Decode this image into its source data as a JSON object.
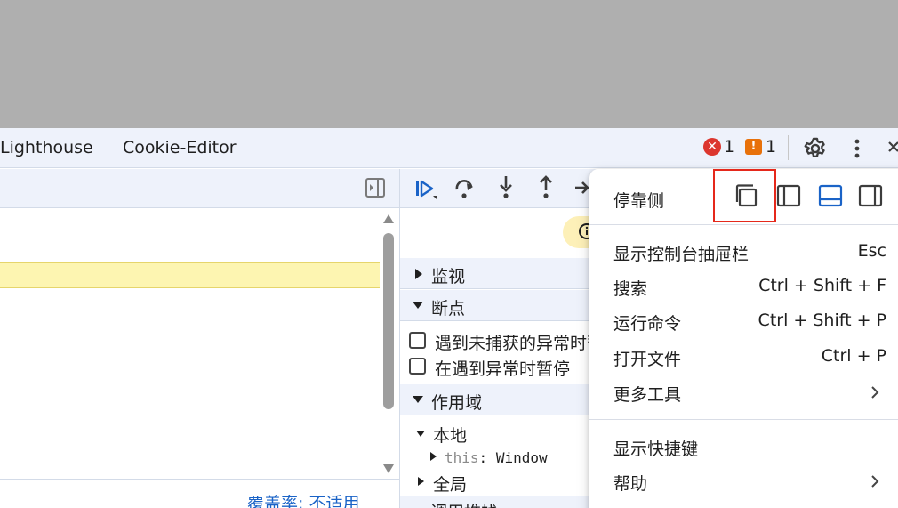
{
  "tabs": {
    "lighthouse": "Lighthouse",
    "cookie_editor": "Cookie-Editor"
  },
  "status": {
    "errors": "1",
    "warnings": "1",
    "error_icon_glyph": "✕",
    "warning_icon_glyph": "!"
  },
  "editor": {
    "coverage": "覆盖率: 不适用"
  },
  "debugger": {
    "sections": {
      "watch": "监视",
      "breakpoints": "断点",
      "scope": "作用域",
      "callstack": "调用堆栈"
    },
    "breakpoint_options": [
      "遇到未捕获的异常时暂停",
      "在遇到异常时暂停"
    ],
    "scope": {
      "local": "本地",
      "this_key": "this",
      "this_sep": ":",
      "this_value": "Window",
      "global": "全局"
    }
  },
  "menu": {
    "dock_label": "停靠侧",
    "dock_options": [
      "undock-into-separate-window-icon",
      "dock-to-left-icon",
      "dock-to-bottom-icon",
      "dock-to-right-icon"
    ],
    "items": [
      {
        "label": "显示控制台抽屉栏",
        "shortcut": "Esc"
      },
      {
        "label": "搜索",
        "shortcut": "Ctrl + Shift + F"
      },
      {
        "label": "运行命令",
        "shortcut": "Ctrl + Shift + P"
      },
      {
        "label": "打开文件",
        "shortcut": "Ctrl + P"
      },
      {
        "label": "更多工具",
        "shortcut": ""
      },
      {
        "label": "显示快捷键",
        "shortcut": ""
      },
      {
        "label": "帮助",
        "shortcut": ""
      }
    ]
  },
  "colors": {
    "accent": "#1a63c7",
    "error": "#dc362e",
    "warning": "#e8710a",
    "highlight": "#fdf5b1",
    "toolbar_bg": "#eef2fb"
  }
}
